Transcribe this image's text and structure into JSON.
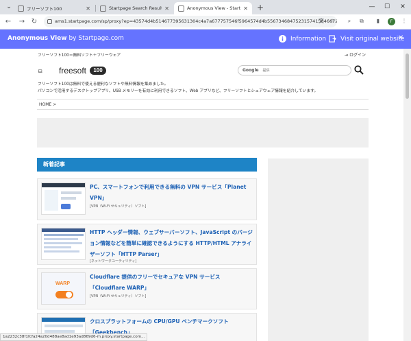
{
  "browser": {
    "tabs": [
      {
        "label": "フリーソフト100",
        "active": false
      },
      {
        "label": "Startpage Search Results",
        "active": false
      },
      {
        "label": "Anonymous View - Startpage",
        "active": true
      }
    ],
    "url": "ams1.startpage.com/sp/proxy?ep=43574d4b514677395631304c4a7a677757546f5964574d4b5567346847523157415846672..."
  },
  "anon_bar": {
    "title": "Anonymous View",
    "by": " by Startpage.com",
    "info_label": "Information",
    "visit_label": "Visit original website"
  },
  "site": {
    "tagline": "フリーソフト100＝無料ソフト＋フリーウェア",
    "login": "ログイン",
    "logo_text": "freesoft",
    "logo_badge": "100",
    "search_brand": "Google",
    "search_placeholder": "提供",
    "description_line1": "フリーソフト100は無料で使える便利なソフトや無料情報を集めました。",
    "description_line2": "パソコンで活用するデスクトップアプリ、USB メモリーを有効に利用できるソフト、Web アプリなど、フリーソフトとシェアウェア情報を紹介しています。",
    "breadcrumb": "HOME >",
    "section_title": "新着記事"
  },
  "articles": [
    {
      "title": "PC、スマートフォンで利用できる無料の VPN サービス「Planet VPN」",
      "category": "[VPN（Wi-Fi セキュリティ）ソフト]"
    },
    {
      "title": "HTTP ヘッダー情報、ウェブサーバーソフト、JavaScript のバージョン情報などを簡単に確認できるようにする HTTP/HTML アナライザーソフト「HTTP Parser」",
      "category": "[ネットワークユーティリティ]"
    },
    {
      "title": "Cloudflare 提供のフリーでセキュアな VPN サービス「Cloudflare WARP」",
      "category": "[VPN（Wi-Fi セキュリティ）ソフト]",
      "thumb_text": "WARP"
    },
    {
      "title": "クロスプラットフォームの CPU/GPU ベンチマークソフト「Geekbench」",
      "category": ""
    }
  ],
  "status_bar": "1a2232c38f1fcfa24a20d488ae8ad1e93ad869d6-m.proxy.startpage.com...",
  "colors": {
    "anon_bar": "#6573ff",
    "section_head": "#1e84c6",
    "link": "#1a5fb4"
  }
}
